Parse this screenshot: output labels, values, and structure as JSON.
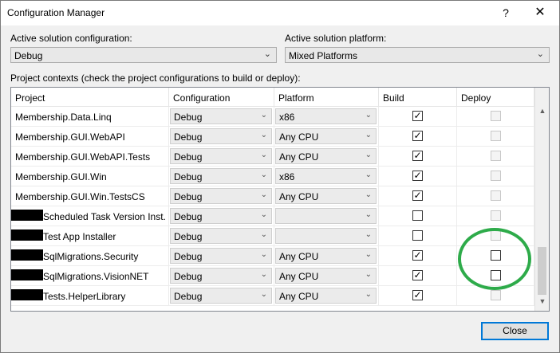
{
  "window": {
    "title": "Configuration Manager",
    "help_label": "?",
    "close_glyph": "✕"
  },
  "active_configuration": {
    "label": "Active solution configuration:",
    "value": "Debug"
  },
  "active_platform": {
    "label": "Active solution platform:",
    "value": "Mixed Platforms"
  },
  "contexts_label": "Project contexts (check the project configurations to build or deploy):",
  "grid": {
    "columns": [
      "Project",
      "Configuration",
      "Platform",
      "Build",
      "Deploy"
    ],
    "rows": [
      {
        "project": "Membership.Data.Linq",
        "configuration": "Debug",
        "platform": "x86",
        "build": true,
        "deploy": false,
        "redacted": false
      },
      {
        "project": "Membership.GUI.WebAPI",
        "configuration": "Debug",
        "platform": "Any CPU",
        "build": true,
        "deploy": false,
        "redacted": false
      },
      {
        "project": "Membership.GUI.WebAPI.Tests",
        "configuration": "Debug",
        "platform": "Any CPU",
        "build": true,
        "deploy": false,
        "redacted": false
      },
      {
        "project": "Membership.GUI.Win",
        "configuration": "Debug",
        "platform": "x86",
        "build": true,
        "deploy": false,
        "redacted": false
      },
      {
        "project": "Membership.GUI.Win.TestsCS",
        "configuration": "Debug",
        "platform": "Any CPU",
        "build": true,
        "deploy": false,
        "redacted": false
      },
      {
        "project": "Scheduled Task Version Inst...",
        "configuration": "Debug",
        "platform": "",
        "build": false,
        "deploy": false,
        "redacted": true
      },
      {
        "project": "Test App Installer",
        "configuration": "Debug",
        "platform": "",
        "build": false,
        "deploy": false,
        "redacted": true
      },
      {
        "project": "SqlMigrations.Security",
        "configuration": "Debug",
        "platform": "Any CPU",
        "build": true,
        "deploy": false,
        "redacted": true
      },
      {
        "project": "SqlMigrations.VisionNET",
        "configuration": "Debug",
        "platform": "Any CPU",
        "build": true,
        "deploy": false,
        "redacted": true
      },
      {
        "project": "Tests.HelperLibrary",
        "configuration": "Debug",
        "platform": "Any CPU",
        "build": true,
        "deploy": false,
        "redacted": true
      }
    ]
  },
  "close_button_label": "Close",
  "colors": {
    "highlight_ring": "#2eab4a",
    "focus_border": "#0078d7"
  },
  "icons": {
    "dropdown": "chevron-down-icon",
    "checkbox": "checkbox-icon"
  }
}
